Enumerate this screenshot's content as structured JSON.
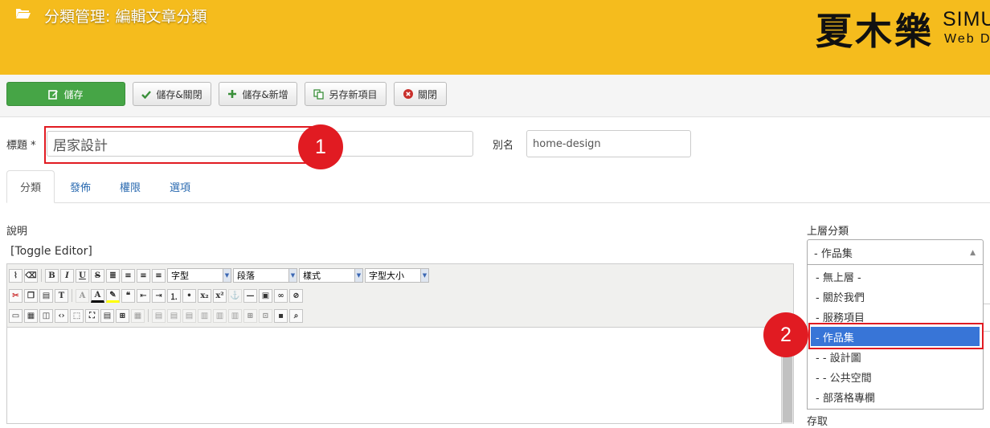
{
  "header": {
    "title": "分類管理: 編輯文章分類",
    "logo_cn": "夏木樂",
    "logo_en_line1": "SIMU",
    "logo_en_line2": "Web D",
    "bg_color": "#f5bc1d"
  },
  "toolbar": {
    "save": "儲存",
    "save_close": "儲存&關閉",
    "save_new": "儲存&新增",
    "save_copy": "另存新項目",
    "close": "關閉"
  },
  "form": {
    "title_label": "標題 *",
    "title_value": "居家設計",
    "alias_label": "別名",
    "alias_value": "home-design"
  },
  "tabs": [
    "分類",
    "發佈",
    "權限",
    "選項"
  ],
  "description": {
    "label": "說明",
    "toggle": "[Toggle Editor]",
    "format_select": "字型",
    "paragraph_select": "段落",
    "style_select": "樣式",
    "size_select": "字型大小"
  },
  "parent": {
    "label": "上層分類",
    "selected": "- 作品集",
    "options": [
      "- 無上層 -",
      "- 關於我們",
      "- 服務項目",
      "- 作品集",
      "- - 設計圖",
      "- - 公共空間",
      "- 部落格專欄"
    ],
    "selected_index": 3
  },
  "callouts": [
    "1",
    "2"
  ],
  "partial_label": "存取",
  "accent_red": "#e11b22",
  "selection_blue": "#3875d7"
}
